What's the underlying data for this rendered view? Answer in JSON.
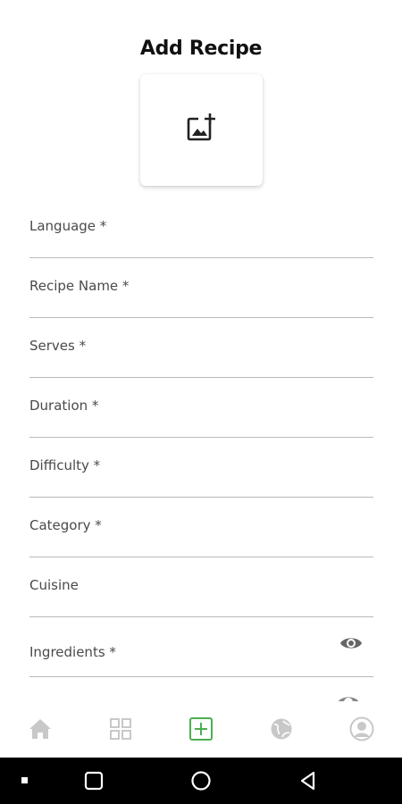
{
  "header": {
    "title": "Add Recipe"
  },
  "image_picker": {
    "icon": "add-photo-icon"
  },
  "form": {
    "fields": [
      {
        "label": "Language *"
      },
      {
        "label": "Recipe Name *"
      },
      {
        "label": "Serves *"
      },
      {
        "label": "Duration *"
      },
      {
        "label": "Difficulty *"
      },
      {
        "label": "Category *"
      },
      {
        "label": "Cuisine"
      },
      {
        "label": "Ingredients *",
        "icon": "eye-icon"
      }
    ]
  },
  "bottom_nav": {
    "items": [
      {
        "icon": "home-icon"
      },
      {
        "icon": "grid-icon"
      },
      {
        "icon": "add-box-icon",
        "active": true
      },
      {
        "icon": "globe-icon"
      },
      {
        "icon": "profile-icon"
      }
    ],
    "active_color": "#4caf50",
    "inactive_color": "#c8c8c8"
  },
  "system_nav": {
    "buttons": [
      "menu",
      "recents",
      "home",
      "back"
    ]
  }
}
